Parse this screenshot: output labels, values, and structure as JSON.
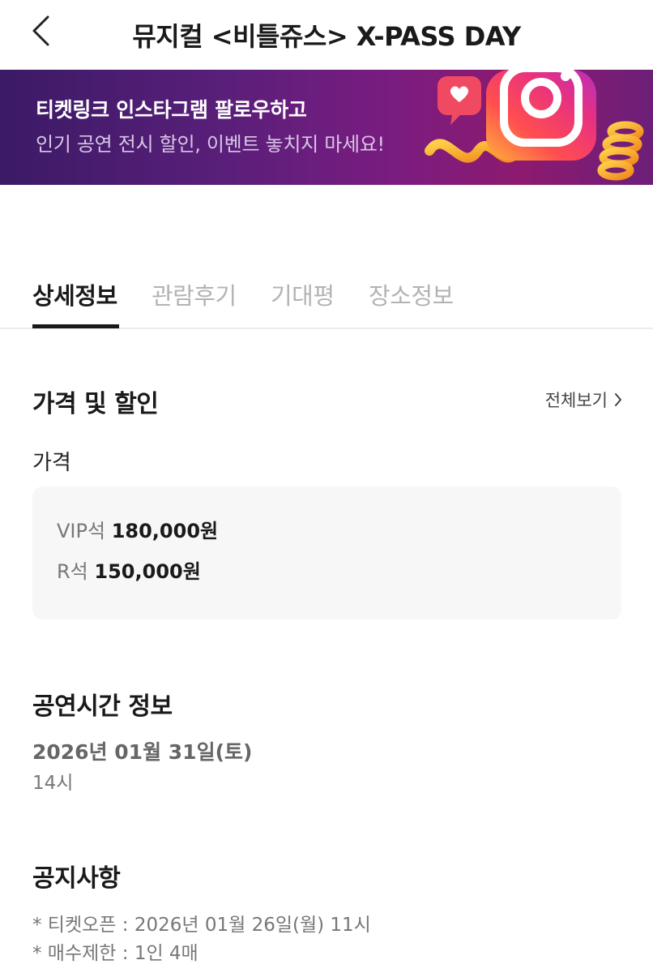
{
  "header": {
    "title": "뮤지컬 <비틀쥬스> X-PASS DAY",
    "back_icon": "chevron-left-icon"
  },
  "banner": {
    "line1": "티켓링크 인스타그램 팔로우하고",
    "line2": "인기 공연 전시 할인, 이벤트 놓치지 마세요!",
    "icons": [
      "instagram-logo-icon",
      "heart-bubble-icon",
      "spiral-icon"
    ]
  },
  "tabs": [
    {
      "label": "상세정보",
      "active": true
    },
    {
      "label": "관람후기",
      "active": false
    },
    {
      "label": "기대평",
      "active": false
    },
    {
      "label": "장소정보",
      "active": false
    }
  ],
  "price_section": {
    "title": "가격 및 할인",
    "see_all": "전체보기",
    "sub_label": "가격",
    "prices": [
      {
        "grade": "VIP석",
        "amount": "180,000원"
      },
      {
        "grade": "R석",
        "amount": "150,000원"
      }
    ]
  },
  "schedule_section": {
    "title": "공연시간 정보",
    "date": "2026년 01월 31일(토)",
    "time": "14시"
  },
  "notice_section": {
    "title": "공지사항",
    "items": [
      "* 티켓오픈 : 2026년 01월 26일(월) 11시",
      "* 매수제한 : 1인 4매"
    ]
  },
  "colors": {
    "banner_start": "#3b1a66",
    "banner_end": "#8d1a6f",
    "active_tab": "#1a1a1a",
    "inactive_tab": "#b3b3b3",
    "price_box_bg": "#f7f7f8"
  }
}
